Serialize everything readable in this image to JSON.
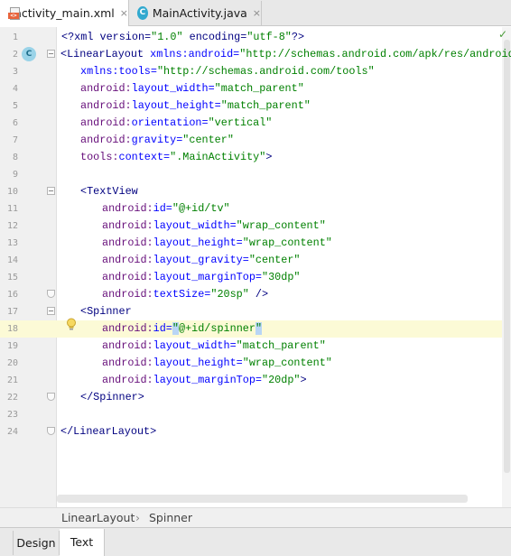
{
  "tabs": [
    {
      "label": "activity_main.xml",
      "icon": "xml-file-icon",
      "active": true,
      "close": "×"
    },
    {
      "label": "MainActivity.java",
      "icon": "java-class-icon",
      "active": false,
      "close": "×"
    }
  ],
  "gutter": {
    "class_marker": "C",
    "status_icon": "check-icon"
  },
  "lines": [
    {
      "n": "1"
    },
    {
      "n": "2"
    },
    {
      "n": "3"
    },
    {
      "n": "4"
    },
    {
      "n": "5"
    },
    {
      "n": "6"
    },
    {
      "n": "7"
    },
    {
      "n": "8"
    },
    {
      "n": "9"
    },
    {
      "n": "10"
    },
    {
      "n": "11"
    },
    {
      "n": "12"
    },
    {
      "n": "13"
    },
    {
      "n": "14"
    },
    {
      "n": "15"
    },
    {
      "n": "16"
    },
    {
      "n": "17"
    },
    {
      "n": "18"
    },
    {
      "n": "19"
    },
    {
      "n": "20"
    },
    {
      "n": "21"
    },
    {
      "n": "22"
    },
    {
      "n": "23"
    },
    {
      "n": "24"
    }
  ],
  "code": {
    "l1": [
      "<?",
      "xml version=",
      "\"1.0\"",
      " encoding=",
      "\"utf-8\"",
      "?>"
    ],
    "l2": [
      "<",
      "LinearLayout ",
      "xmlns:android=",
      "\"http://schemas.android.com/apk/res/android\""
    ],
    "l3": [
      "xmlns:tools=",
      "\"http://schemas.android.com/tools\""
    ],
    "l4": [
      "android:",
      "layout_width=",
      "\"match_parent\""
    ],
    "l5": [
      "android:",
      "layout_height=",
      "\"match_parent\""
    ],
    "l6": [
      "android:",
      "orientation=",
      "\"vertical\""
    ],
    "l7": [
      "android:",
      "gravity=",
      "\"center\""
    ],
    "l8": [
      "tools:",
      "context=",
      "\".MainActivity\"",
      ">"
    ],
    "l10": [
      "<",
      "TextView"
    ],
    "l11": [
      "android:",
      "id=",
      "\"@+id/tv\""
    ],
    "l12": [
      "android:",
      "layout_width=",
      "\"wrap_content\""
    ],
    "l13": [
      "android:",
      "layout_height=",
      "\"wrap_content\""
    ],
    "l14": [
      "android:",
      "layout_gravity=",
      "\"center\""
    ],
    "l15": [
      "android:",
      "layout_marginTop=",
      "\"30dp\""
    ],
    "l16": [
      "android:",
      "textSize=",
      "\"20sp\"",
      " />"
    ],
    "l17": [
      "<",
      "Spinner"
    ],
    "l18": [
      "android:",
      "id=",
      "\"",
      "@+id/spinner",
      "\""
    ],
    "l19": [
      "android:",
      "layout_width=",
      "\"match_parent\""
    ],
    "l20": [
      "android:",
      "layout_height=",
      "\"wrap_content\""
    ],
    "l21": [
      "android:",
      "layout_marginTop=",
      "\"20dp\"",
      ">"
    ],
    "l22": [
      "</",
      "Spinner",
      ">"
    ],
    "l24": [
      "</",
      "LinearLayout",
      ">"
    ]
  },
  "current_line": "18",
  "breadcrumb": {
    "items": [
      "LinearLayout",
      "Spinner"
    ],
    "separator": "›"
  },
  "bottom_tabs": [
    {
      "label": "Design",
      "active": false
    },
    {
      "label": "Text",
      "active": true
    }
  ],
  "colors": {
    "tag": "#000080",
    "namespace": "#660e7a",
    "attribute": "#0000ff",
    "value": "#008000",
    "current_line_bg": "#fcfad6",
    "selection": "#b8d5f5"
  }
}
